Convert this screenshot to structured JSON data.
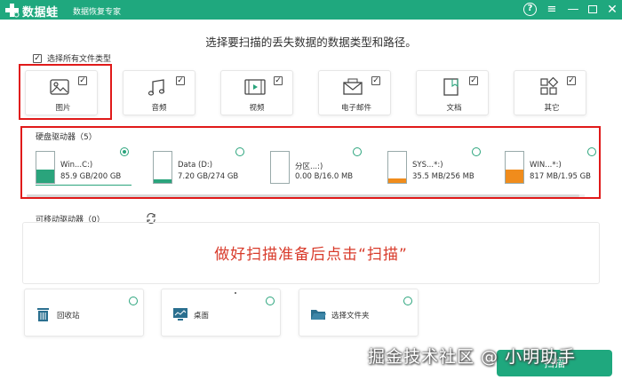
{
  "titlebar": {
    "app_name": "数据蛙",
    "app_sub": "数据恢复专家",
    "help": "?",
    "menu": "≡",
    "minimize": "—",
    "close": "✕"
  },
  "headline": "选择要扫描的丢失数据的数据类型和路径。",
  "select_all": {
    "label": "选择所有文件类型",
    "checked": true
  },
  "file_types": [
    {
      "label": "图片",
      "icon": "image-icon",
      "checked": true
    },
    {
      "label": "音频",
      "icon": "music-icon",
      "checked": true
    },
    {
      "label": "视频",
      "icon": "video-icon",
      "checked": true
    },
    {
      "label": "电子邮件",
      "icon": "email-icon",
      "checked": true
    },
    {
      "label": "文档",
      "icon": "document-icon",
      "checked": true
    },
    {
      "label": "其它",
      "icon": "other-icon",
      "checked": true
    }
  ],
  "hard_drives": {
    "label": "硬盘驱动器（5）",
    "items": [
      {
        "name": "Win...C:)",
        "size": "85.9 GB/200 GB",
        "used": 0.43,
        "color": "#2aa47c",
        "selected": true
      },
      {
        "name": "Data (D:)",
        "size": "7.20 GB/274 GB",
        "used": 0.03,
        "color": "#2aa47c",
        "selected": false
      },
      {
        "name": "分区...:)",
        "size": "0.00  B/16.0 MB",
        "used": 0.0,
        "color": "#f08c1c",
        "selected": false
      },
      {
        "name": "SYS...*:)",
        "size": "35.5 MB/256 MB",
        "used": 0.14,
        "color": "#f08c1c",
        "selected": false
      },
      {
        "name": "WIN...*:)",
        "size": "817 MB/1.95 GB",
        "used": 0.42,
        "color": "#f08c1c",
        "selected": false
      }
    ]
  },
  "removable": {
    "label": "可移动驱动器（0）"
  },
  "hint": "做好扫描准备后点击“扫描”",
  "locations": [
    {
      "label": "回收站",
      "icon": "recycle-bin-icon"
    },
    {
      "label": "桌面",
      "icon": "desktop-icon"
    },
    {
      "label": "选择文件夹",
      "icon": "folder-icon"
    }
  ],
  "watermark": "掘金技术社区 @ 小明助手",
  "scan_button": "扫描",
  "colors": {
    "brand": "#1fa87e",
    "highlight": "#e01a1a",
    "hint": "#d83a2a"
  }
}
